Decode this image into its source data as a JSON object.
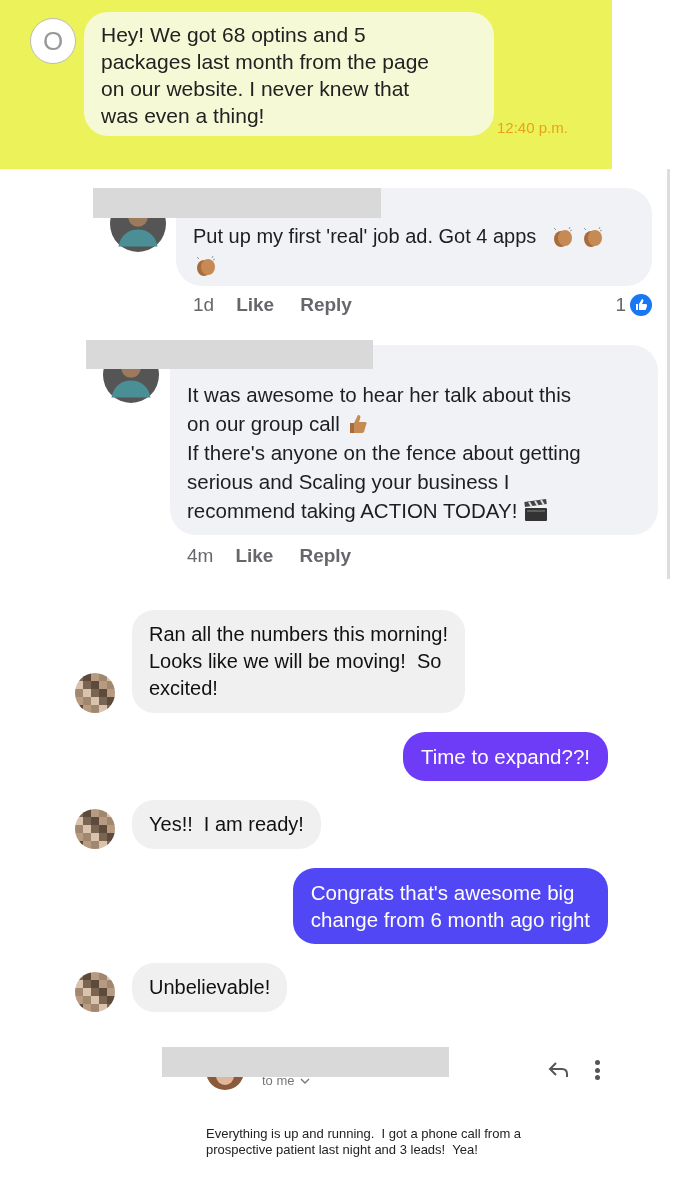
{
  "sms": {
    "avatar_letter": "O",
    "lines": [
      "Hey! We got 68 optins and 5",
      "packages last month from the page",
      "on our website. I never knew that",
      "was even a thing!"
    ],
    "time": "12:40 p.m."
  },
  "comments": [
    {
      "lines": [
        "Put up my first 'real' job ad. Got 4 apps"
      ],
      "age": "1d",
      "like": "Like",
      "reply": "Reply",
      "reaction_count": "1"
    },
    {
      "lines": [
        "It was awesome to hear her talk about this",
        "on our group call",
        "If there's anyone on the fence about getting",
        "serious and Scaling your business I",
        "recommend taking ACTION TODAY!"
      ],
      "age": "4m",
      "like": "Like",
      "reply": "Reply"
    }
  ],
  "messages": [
    {
      "kind": "incoming",
      "lines": [
        "Ran all the numbers this morning!",
        "Looks like we will be moving!  So",
        "excited!"
      ]
    },
    {
      "kind": "outgoing",
      "lines": [
        "Time to expand??!"
      ],
      "color": "#6e3cf6"
    },
    {
      "kind": "incoming",
      "lines": [
        "Yes!!  I am ready!"
      ]
    },
    {
      "kind": "outgoing",
      "lines": [
        "Congrats that's awesome big",
        "change from 6 month ago right"
      ],
      "color": "#5147f5"
    },
    {
      "kind": "incoming",
      "lines": [
        "Unbelievable!"
      ]
    }
  ],
  "email": {
    "recipient": "to me",
    "lines": [
      "Everything is up and running.  I got a phone call from a",
      "prospective patient last night and 3 leads!  Yea!"
    ]
  }
}
